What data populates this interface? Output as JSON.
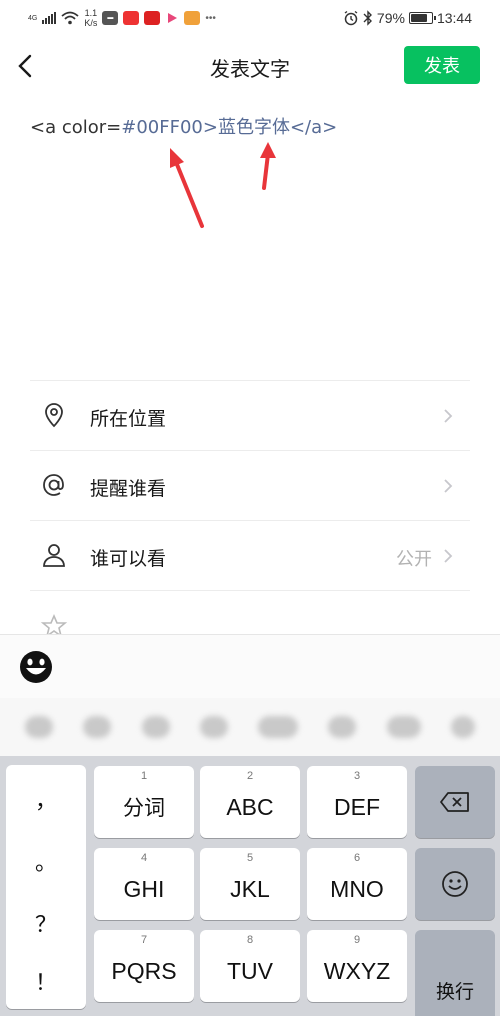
{
  "status_bar": {
    "network": "4G",
    "speed_value": "1.1",
    "speed_unit": "K/s",
    "app_icons": [
      "app-icon-toutiao",
      "app-icon-toutiao-2",
      "app-icon-video",
      "app-icon-news"
    ],
    "battery_percent": "79%",
    "battery_level": 0.79,
    "time": "13:44"
  },
  "navbar": {
    "title": "发表文字",
    "publish_label": "发表"
  },
  "compose": {
    "text_prefix": "<a color=",
    "text_color_code": "#00FF00",
    "text_gt": ">",
    "text_content": "蓝色字体",
    "text_suffix": "</a>"
  },
  "options": [
    {
      "icon": "location-pin-icon",
      "label": "所在位置",
      "value": ""
    },
    {
      "icon": "at-sign-icon",
      "label": "提醒谁看",
      "value": ""
    },
    {
      "icon": "person-icon",
      "label": "谁可以看",
      "value": "公开"
    }
  ],
  "keyboard": {
    "punctuation": [
      "，",
      "。",
      "？",
      "！"
    ],
    "keys": [
      {
        "num": "1",
        "label": "分词"
      },
      {
        "num": "2",
        "label": "ABC"
      },
      {
        "num": "3",
        "label": "DEF"
      },
      {
        "num": "4",
        "label": "GHI"
      },
      {
        "num": "5",
        "label": "JKL"
      },
      {
        "num": "6",
        "label": "MNO"
      },
      {
        "num": "7",
        "label": "PQRS"
      },
      {
        "num": "8",
        "label": "TUV"
      },
      {
        "num": "9",
        "label": "WXYZ"
      }
    ],
    "enter_label": "换行"
  },
  "colors": {
    "accent_green": "#07c160",
    "link_blue": "#576b95",
    "arrow_red": "#e8353a",
    "keyboard_bg": "#d3d5da"
  }
}
